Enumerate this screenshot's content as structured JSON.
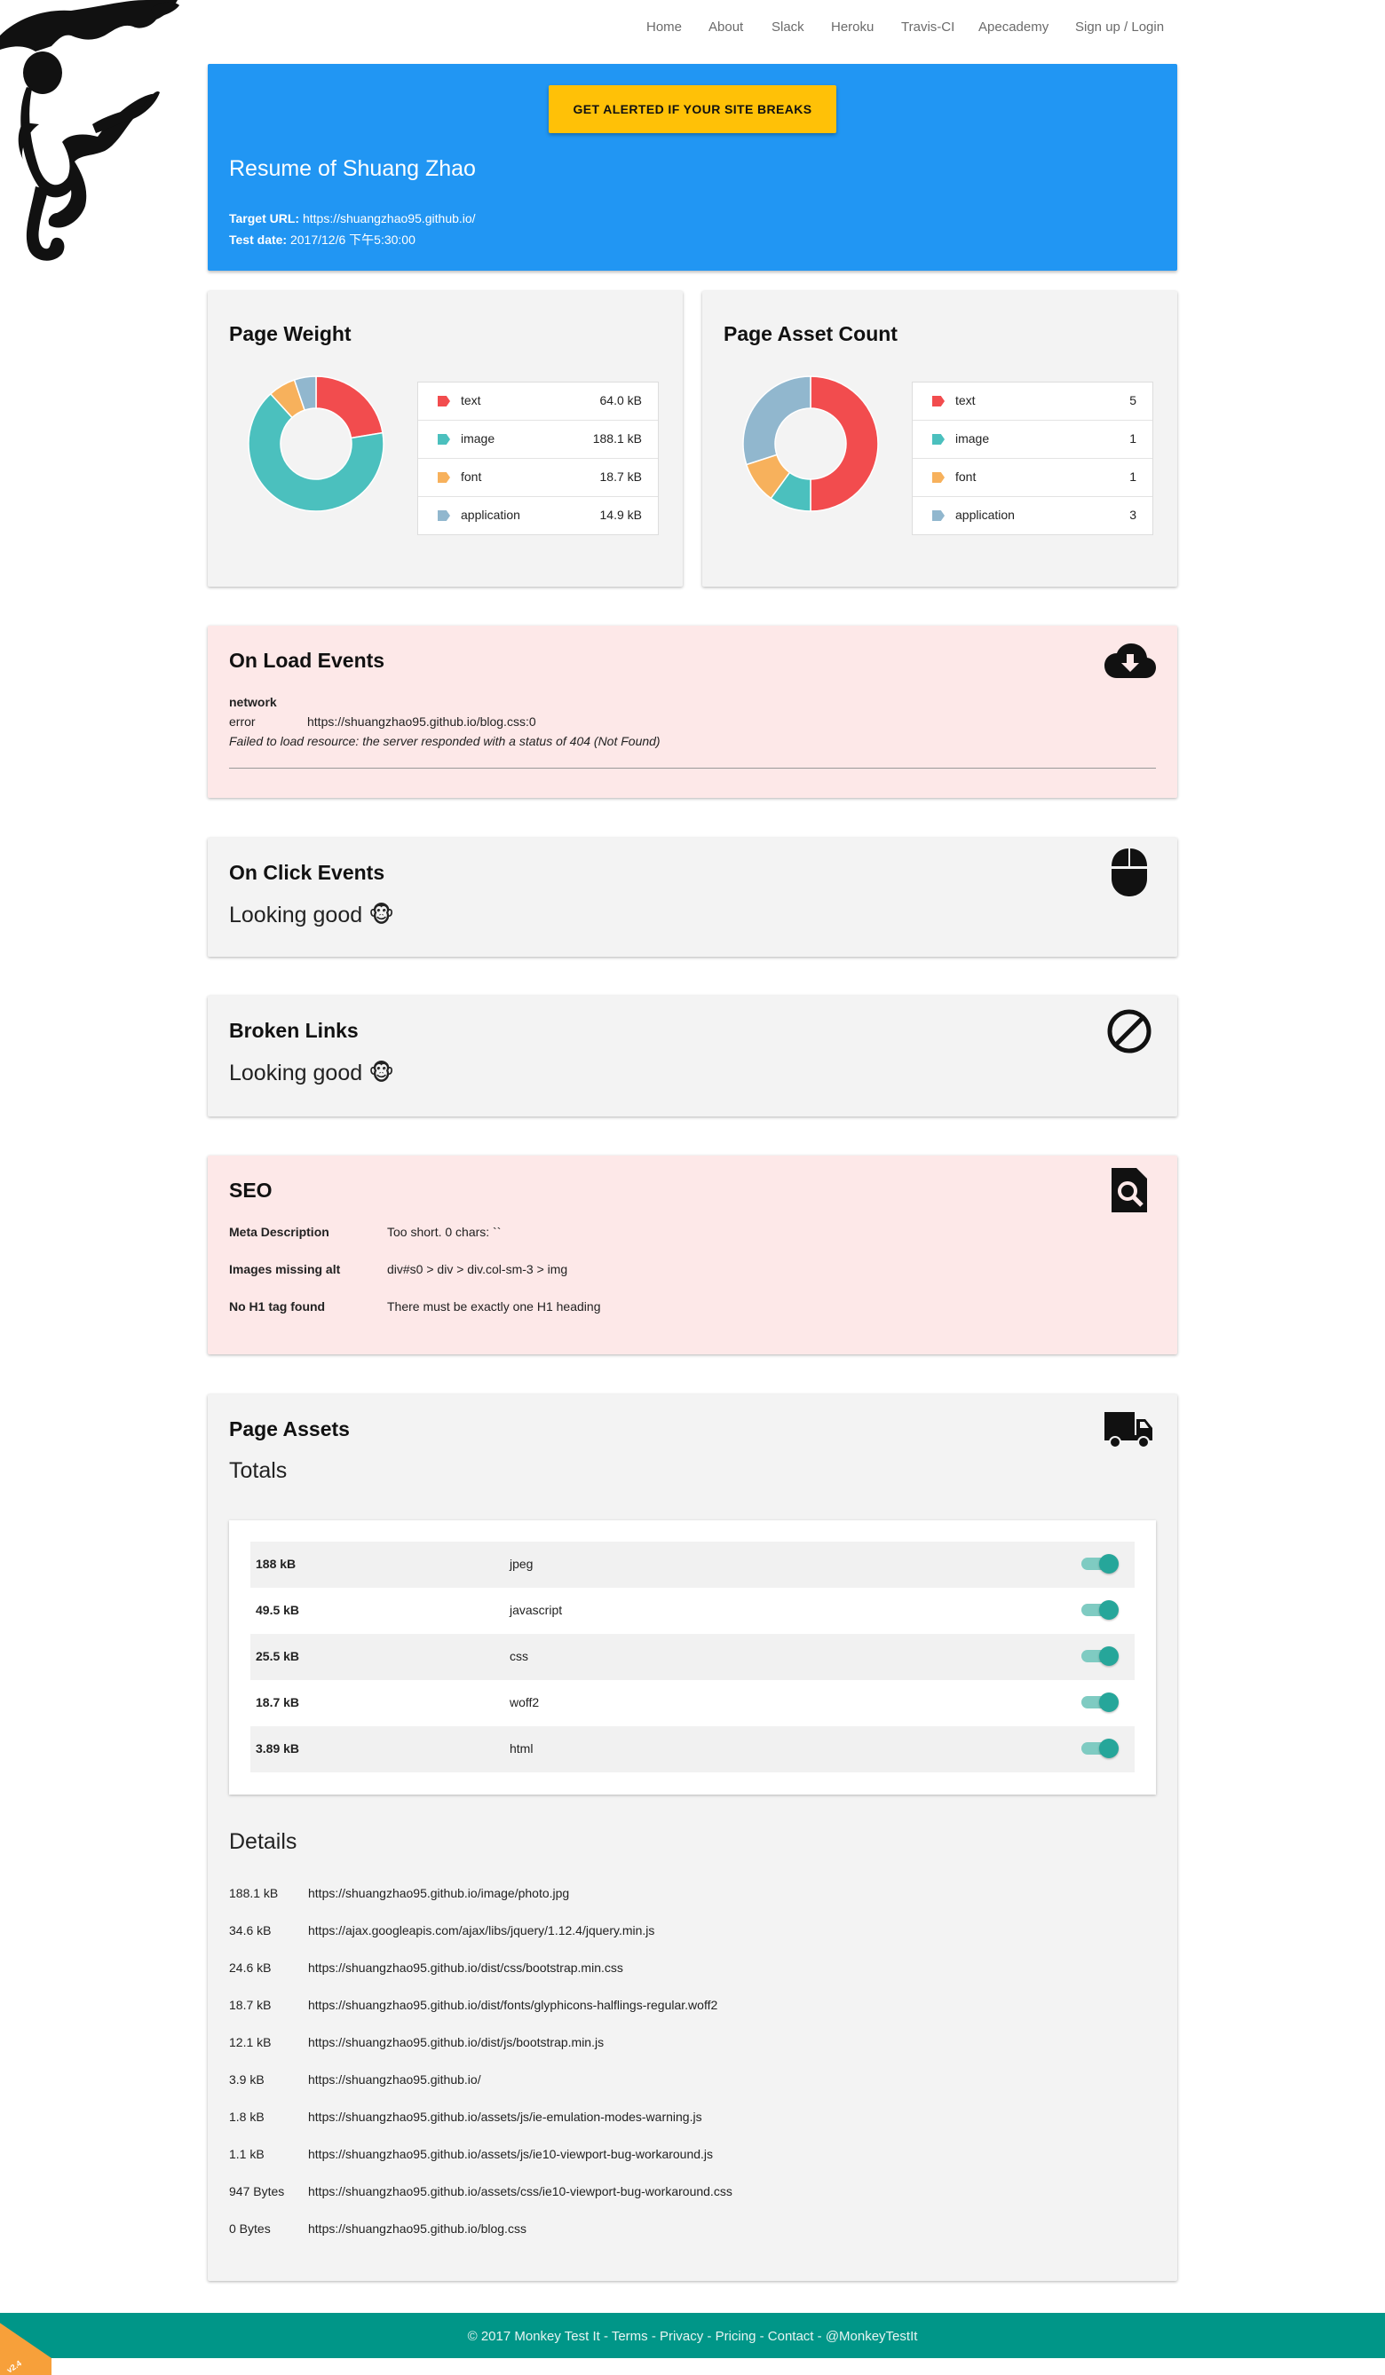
{
  "nav": {
    "items": [
      "Home",
      "About",
      "Slack",
      "Heroku",
      "Travis-CI",
      "Apecademy",
      "Sign up / Login"
    ]
  },
  "hero": {
    "cta_label": "GET ALERTED IF YOUR SITE BREAKS",
    "title": "Resume of Shuang Zhao",
    "target_label": "Target URL:",
    "target_value": "https://shuangzhao95.github.io/",
    "date_label": "Test date:",
    "date_value": "2017/12/6 下午5:30:00"
  },
  "colors": {
    "text": "#F24C4E",
    "image": "#4BC0BE",
    "font": "#F7B15C",
    "application": "#91B7CE",
    "hero": "#2196F3",
    "accent": "#009688"
  },
  "page_weight": {
    "title": "Page Weight",
    "rows": [
      {
        "label": "text",
        "value": "64.0 kB",
        "amount": 64.0
      },
      {
        "label": "image",
        "value": "188.1 kB",
        "amount": 188.1
      },
      {
        "label": "font",
        "value": "18.7 kB",
        "amount": 18.7
      },
      {
        "label": "application",
        "value": "14.9 kB",
        "amount": 14.9
      }
    ]
  },
  "asset_count": {
    "title": "Page Asset Count",
    "rows": [
      {
        "label": "text",
        "value": "5",
        "amount": 5
      },
      {
        "label": "image",
        "value": "1",
        "amount": 1
      },
      {
        "label": "font",
        "value": "1",
        "amount": 1
      },
      {
        "label": "application",
        "value": "3",
        "amount": 3
      }
    ]
  },
  "on_load": {
    "title": "On Load Events",
    "icon": "cloud-download-icon",
    "category": "network",
    "level": "error",
    "url": "https://shuangzhao95.github.io/blog.css:0",
    "message": "Failed to load resource: the server responded with a status of 404 (Not Found)"
  },
  "on_click": {
    "title": "On Click Events",
    "icon": "mouse-icon",
    "status": "Looking good 🐵"
  },
  "broken_links": {
    "title": "Broken Links",
    "icon": "ban-icon",
    "status": "Looking good 🐵"
  },
  "seo": {
    "title": "SEO",
    "icon": "search-file-icon",
    "rows": [
      {
        "label": "Meta Description",
        "value": "Too short. 0 chars: ``"
      },
      {
        "label": "Images missing alt",
        "value": "div#s0 > div > div.col-sm-3 > img"
      },
      {
        "label": "No H1 tag found",
        "value": "There must be exactly one H1 heading"
      }
    ]
  },
  "page_assets": {
    "title": "Page Assets",
    "icon": "truck-icon",
    "totals_title": "Totals",
    "totals": [
      {
        "size": "188 kB",
        "type": "jpeg",
        "enabled": true
      },
      {
        "size": "49.5 kB",
        "type": "javascript",
        "enabled": true
      },
      {
        "size": "25.5 kB",
        "type": "css",
        "enabled": true
      },
      {
        "size": "18.7 kB",
        "type": "woff2",
        "enabled": true
      },
      {
        "size": "3.89 kB",
        "type": "html",
        "enabled": true
      }
    ],
    "details_title": "Details",
    "details": [
      {
        "size": "188.1 kB",
        "url": "https://shuangzhao95.github.io/image/photo.jpg"
      },
      {
        "size": "34.6 kB",
        "url": "https://ajax.googleapis.com/ajax/libs/jquery/1.12.4/jquery.min.js"
      },
      {
        "size": "24.6 kB",
        "url": "https://shuangzhao95.github.io/dist/css/bootstrap.min.css"
      },
      {
        "size": "18.7 kB",
        "url": "https://shuangzhao95.github.io/dist/fonts/glyphicons-halflings-regular.woff2"
      },
      {
        "size": "12.1 kB",
        "url": "https://shuangzhao95.github.io/dist/js/bootstrap.min.js"
      },
      {
        "size": "3.9 kB",
        "url": "https://shuangzhao95.github.io/"
      },
      {
        "size": "1.8 kB",
        "url": "https://shuangzhao95.github.io/assets/js/ie-emulation-modes-warning.js"
      },
      {
        "size": "1.1 kB",
        "url": "https://shuangzhao95.github.io/assets/js/ie10-viewport-bug-workaround.js"
      },
      {
        "size": "947 Bytes",
        "url": "https://shuangzhao95.github.io/assets/css/ie10-viewport-bug-workaround.css"
      },
      {
        "size": "0 Bytes",
        "url": "https://shuangzhao95.github.io/blog.css"
      }
    ]
  },
  "footer": {
    "copyright": "© 2017 Monkey Test It",
    "links": [
      "Terms",
      "Privacy",
      "Pricing",
      "Contact",
      "@MonkeyTestIt"
    ],
    "separator": " - ",
    "version": "v2.4"
  }
}
